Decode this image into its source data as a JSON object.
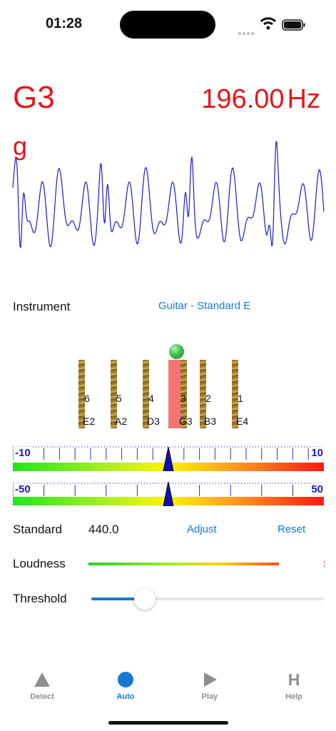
{
  "status_bar": {
    "time": "01:28"
  },
  "tuner": {
    "note": "G3",
    "note_lower": "g",
    "frequency": "196.00",
    "frequency_unit": "Hz"
  },
  "instrument": {
    "label": "Instrument",
    "value": "Guitar - Standard E"
  },
  "strings": [
    {
      "number": "6",
      "note": "E2"
    },
    {
      "number": "5",
      "note": "A2"
    },
    {
      "number": "4",
      "note": "D3"
    },
    {
      "number": "3",
      "note": "G3"
    },
    {
      "number": "2",
      "note": "B3"
    },
    {
      "number": "1",
      "note": "E4"
    }
  ],
  "active_string_index": 3,
  "meters": {
    "coarse": {
      "min_label": "-10",
      "max_label": "10",
      "value": 0
    },
    "fine": {
      "min_label": "-50",
      "max_label": "50",
      "value": 0
    }
  },
  "standard": {
    "label": "Standard",
    "value": "440.0",
    "adjust_label": "Adjust",
    "reset_label": "Reset"
  },
  "loudness": {
    "label": "Loudness",
    "level_percent": 81
  },
  "threshold": {
    "label": "Threshold",
    "value_percent": 23
  },
  "tabs": [
    {
      "label": "Detect",
      "icon": "triangle-icon",
      "active": false
    },
    {
      "label": "Auto",
      "icon": "circle-icon",
      "active": true
    },
    {
      "label": "Play",
      "icon": "play-icon",
      "active": false
    },
    {
      "label": "Help",
      "icon": "h-icon",
      "active": false
    }
  ],
  "colors": {
    "accent": "#1478d4",
    "note": "#e8141c",
    "waveform": "#1a1ad0",
    "inactive_tab": "#8e8e8e"
  }
}
